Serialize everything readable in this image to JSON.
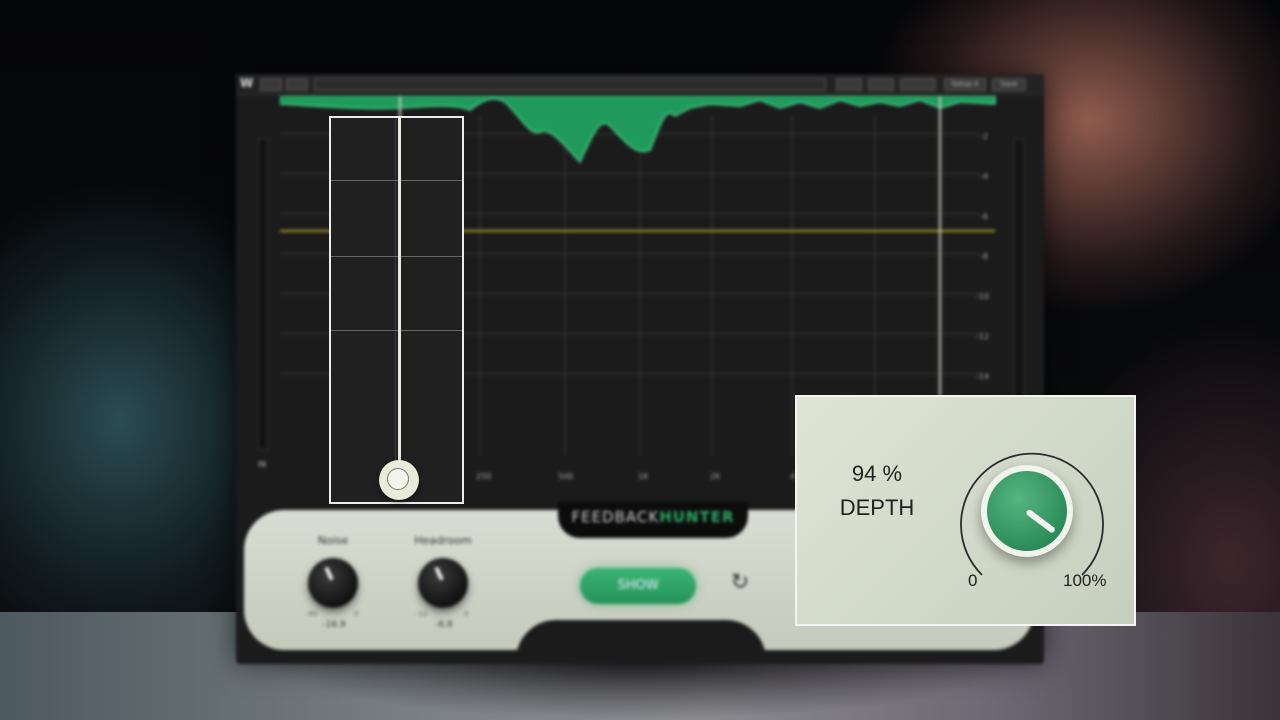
{
  "plugin": {
    "logo": "W",
    "brand_part1": "FEEDBACK",
    "brand_part2": "HUNTER",
    "meter_label": "IN",
    "db_ticks": [
      "-2",
      "-4",
      "-6",
      "-8",
      "-10",
      "-12",
      "-14"
    ],
    "freq_ticks": [
      "250",
      "500",
      "1K",
      "2K",
      "4"
    ],
    "toolbar_buttons": [
      "Setup A",
      "Save"
    ],
    "controls": {
      "noise_label": "Noise",
      "noise_min": "-40",
      "noise_max": "0",
      "noise_value": "-16.9",
      "headroom_label": "Headroom",
      "headroom_min": "-12",
      "headroom_max": "0",
      "headroom_value": "-6.8",
      "show_label": "SHOW"
    }
  },
  "depth": {
    "value": "94 %",
    "label": "DEPTH",
    "min": "0",
    "max": "100%",
    "fraction": 0.94
  },
  "colors": {
    "accent_green": "#2fa96b",
    "threshold_yellow": "#a8a020",
    "panel_bg": "#d3d9cb"
  }
}
